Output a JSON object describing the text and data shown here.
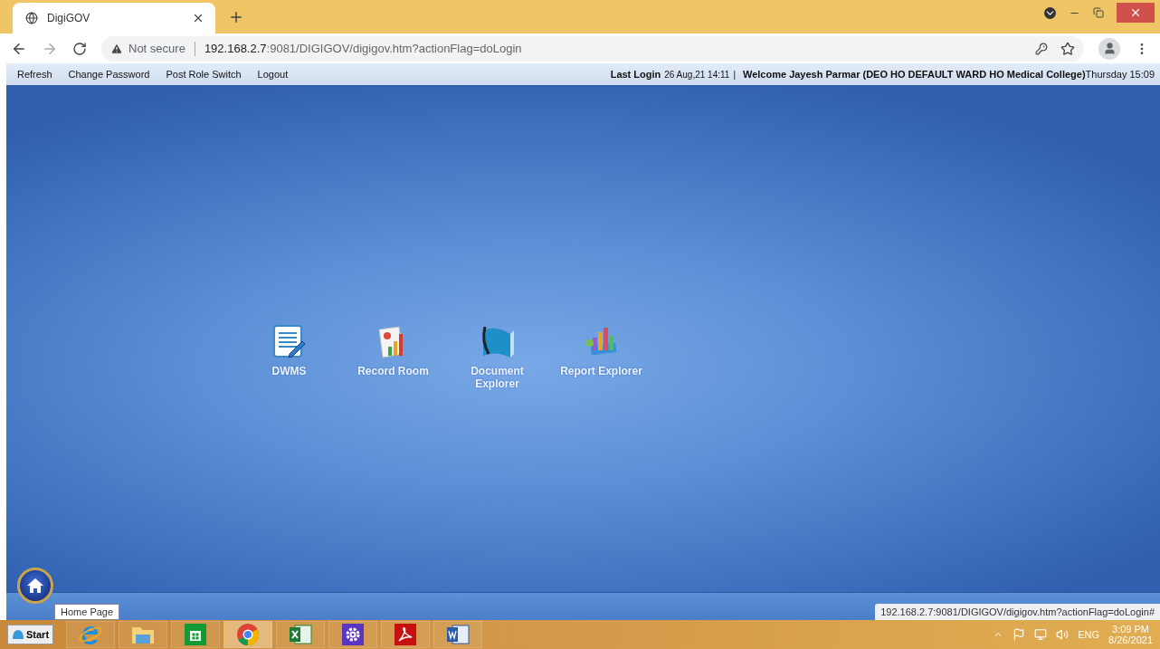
{
  "browser": {
    "tab_title": "DigiGOV",
    "security": "Not secure",
    "url_host": "192.168.2.7",
    "url_path": ":9081/DIGIGOV/digigov.htm?actionFlag=doLogin"
  },
  "menu": [
    "Refresh",
    "Change Password",
    "Post Role Switch",
    "Logout"
  ],
  "session": {
    "last_login_label": "Last Login",
    "last_login_value": "26 Aug,21 14:11",
    "separator": "|",
    "welcome": "Welcome Jayesh Parmar (DEO HO DEFAULT WARD HO Medical College)",
    "day_time": "Thursday 15:09"
  },
  "apps": [
    {
      "label": "DWMS",
      "kind": "document"
    },
    {
      "label": "Record Room",
      "kind": "chart"
    },
    {
      "label": "Document Explorer",
      "kind": "book"
    },
    {
      "label": "Report Explorer",
      "kind": "report"
    }
  ],
  "home_tooltip": "Home Page",
  "status_url": "192.168.2.7:9081/DIGIGOV/digigov.htm?actionFlag=doLogin#",
  "taskbar": {
    "start": "Start",
    "apps": [
      {
        "kind": "ie",
        "selected": false
      },
      {
        "kind": "explorer",
        "selected": false
      },
      {
        "kind": "store",
        "selected": false
      },
      {
        "kind": "chrome",
        "selected": true
      },
      {
        "kind": "excel",
        "selected": false
      },
      {
        "kind": "settings",
        "selected": false
      },
      {
        "kind": "pdf",
        "selected": false
      },
      {
        "kind": "word",
        "selected": false
      }
    ],
    "language": "ENG",
    "time": "3:09 PM",
    "date": "8/26/2021"
  }
}
